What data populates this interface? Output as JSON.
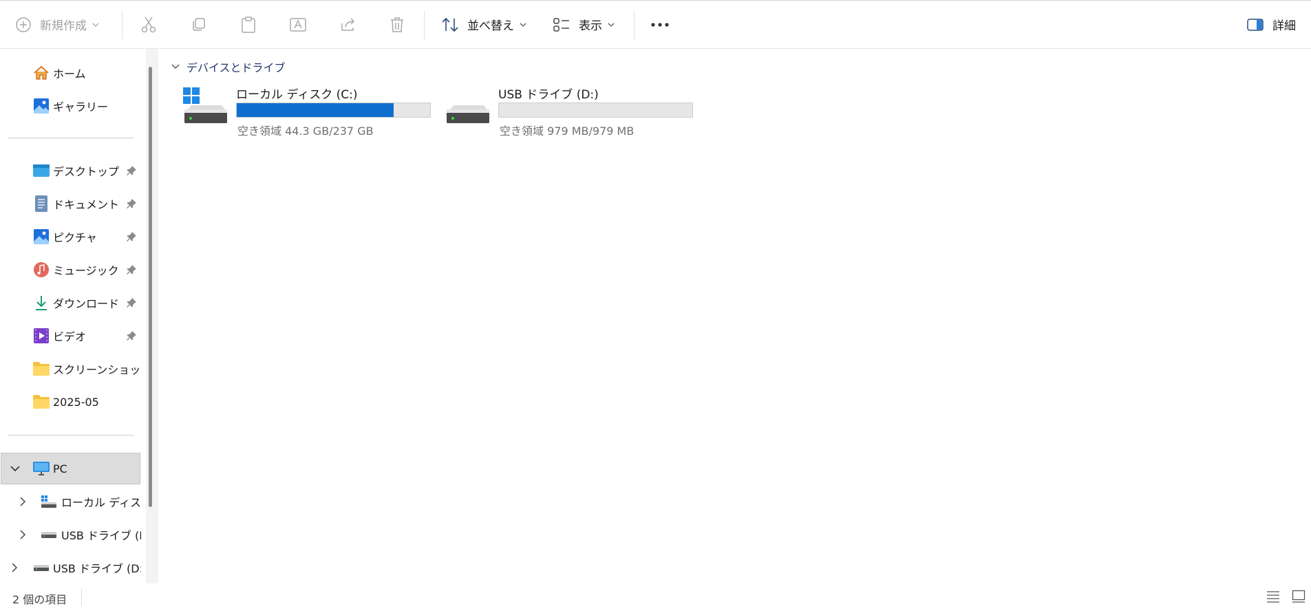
{
  "toolbar": {
    "new_label": "新規作成",
    "sort_label": "並べ替え",
    "view_label": "表示",
    "details_label": "詳細"
  },
  "sidebar": {
    "quick": [
      {
        "label": "ホーム",
        "icon": "home-icon"
      },
      {
        "label": "ギャラリー",
        "icon": "gallery-icon"
      }
    ],
    "pinned": [
      {
        "label": "デスクトップ",
        "icon": "desktop-folder-icon",
        "pinned": true
      },
      {
        "label": "ドキュメント",
        "icon": "documents-folder-icon",
        "pinned": true
      },
      {
        "label": "ピクチャ",
        "icon": "pictures-folder-icon",
        "pinned": true
      },
      {
        "label": "ミュージック",
        "icon": "music-folder-icon",
        "pinned": true
      },
      {
        "label": "ダウンロード",
        "icon": "downloads-icon",
        "pinned": true
      },
      {
        "label": "ビデオ",
        "icon": "videos-folder-icon",
        "pinned": true
      },
      {
        "label": "スクリーンショット",
        "icon": "folder-icon",
        "pinned": false
      },
      {
        "label": "2025-05",
        "icon": "folder-icon",
        "pinned": false
      }
    ],
    "tree": [
      {
        "label": "PC",
        "icon": "pc-icon",
        "expanded": true,
        "selected": true
      },
      {
        "label": "ローカル ディスク",
        "icon": "local-disk-icon"
      },
      {
        "label": "USB ドライブ (D:",
        "icon": "usb-drive-icon"
      },
      {
        "label": "USB ドライブ (D:)",
        "icon": "usb-drive-icon"
      }
    ]
  },
  "main": {
    "section_title": "デバイスとドライブ",
    "drives": [
      {
        "name": "ローカル ディスク (C:)",
        "free_text": "空き領域 44.3 GB/237 GB",
        "used_fraction": 0.81
      },
      {
        "name": "USB ドライブ (D:)",
        "free_text": "空き領域 979 MB/979 MB",
        "used_fraction": 0.0
      }
    ]
  },
  "status": {
    "item_count": "2 個の項目"
  },
  "colors": {
    "accent": "#0f6fcf",
    "selection": "#dcdcdc",
    "section_text": "#20376e"
  }
}
